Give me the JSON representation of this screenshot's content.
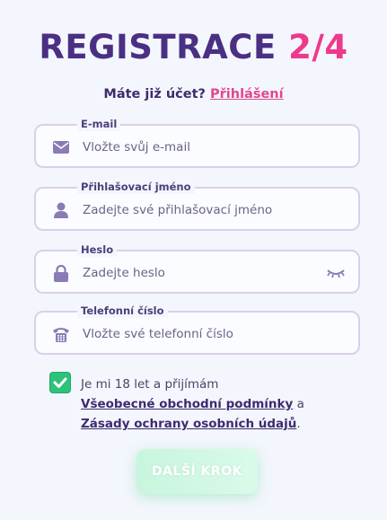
{
  "title": {
    "main": "REGISTRACE",
    "step": "2/4"
  },
  "login": {
    "prompt": "Máte již účet?",
    "link": "Přihlášení"
  },
  "fields": [
    {
      "label": "E-mail",
      "placeholder": "Vložte svůj e-mail",
      "icon": "envelope-icon"
    },
    {
      "label": "Přihlašovací jméno",
      "placeholder": "Zadejte své přihlašovací jméno",
      "icon": "user-icon"
    },
    {
      "label": "Heslo",
      "placeholder": "Zadejte heslo",
      "icon": "lock-icon"
    },
    {
      "label": "Telefonní číslo",
      "placeholder": "Vložte své telefonní číslo",
      "icon": "phone-icon"
    }
  ],
  "consent": {
    "checked": true,
    "text_before": "Je mi 18 let a přijímám",
    "terms_link": "Všeobecné obchodní podmínky",
    "and": "a",
    "privacy_link": "Zásady ochrany osobních údajů",
    "end": "."
  },
  "next_button": {
    "label": "DALŠÍ KROK"
  },
  "colors": {
    "primary": "#4b2f83",
    "accent": "#ee3a8c",
    "success": "#2ec27a"
  }
}
